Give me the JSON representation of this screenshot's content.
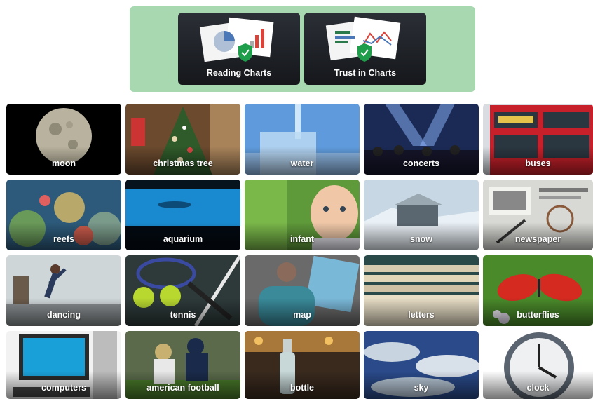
{
  "header": {
    "cards": [
      {
        "label": "Reading Charts",
        "icon": "pie-chart-shield-icon"
      },
      {
        "label": "Trust in Charts",
        "icon": "line-chart-shield-icon"
      }
    ]
  },
  "topics": [
    {
      "label": "moon"
    },
    {
      "label": "christmas tree"
    },
    {
      "label": "water"
    },
    {
      "label": "concerts"
    },
    {
      "label": "buses"
    },
    {
      "label": "reefs"
    },
    {
      "label": "aquarium"
    },
    {
      "label": "infant"
    },
    {
      "label": "snow"
    },
    {
      "label": "newspaper"
    },
    {
      "label": "dancing"
    },
    {
      "label": "tennis"
    },
    {
      "label": "map"
    },
    {
      "label": "letters"
    },
    {
      "label": "butterflies"
    },
    {
      "label": "computers"
    },
    {
      "label": "american football"
    },
    {
      "label": "bottle"
    },
    {
      "label": "sky"
    },
    {
      "label": "clock"
    }
  ],
  "colors": {
    "banner": "#a8d8b0",
    "card": "#1f2227",
    "shield": "#1e9e4a"
  }
}
